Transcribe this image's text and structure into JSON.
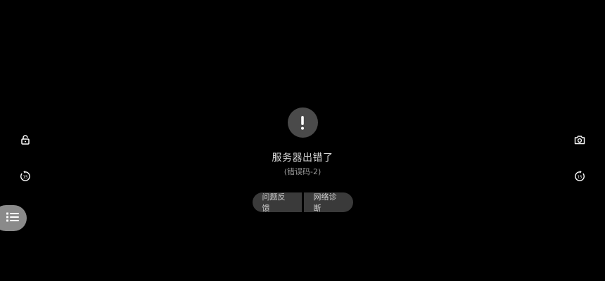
{
  "error": {
    "title": "服务器出错了",
    "code": "(错误码-2)",
    "icon": "exclamation-icon"
  },
  "actions": {
    "feedback_label": "问题反馈",
    "diagnose_label": "网络诊断"
  },
  "controls": {
    "left": [
      "unlock-icon",
      "rewind-15-icon",
      "list-icon"
    ],
    "right": [
      "camera-icon",
      "forward-15-icon"
    ],
    "rewind_seconds": "15",
    "forward_seconds": "15"
  },
  "colors": {
    "background": "#000000",
    "error_circle": "#4a4a4a",
    "button_bg": "#3a3a3a",
    "list_button_bg": "#8a8a8a"
  }
}
